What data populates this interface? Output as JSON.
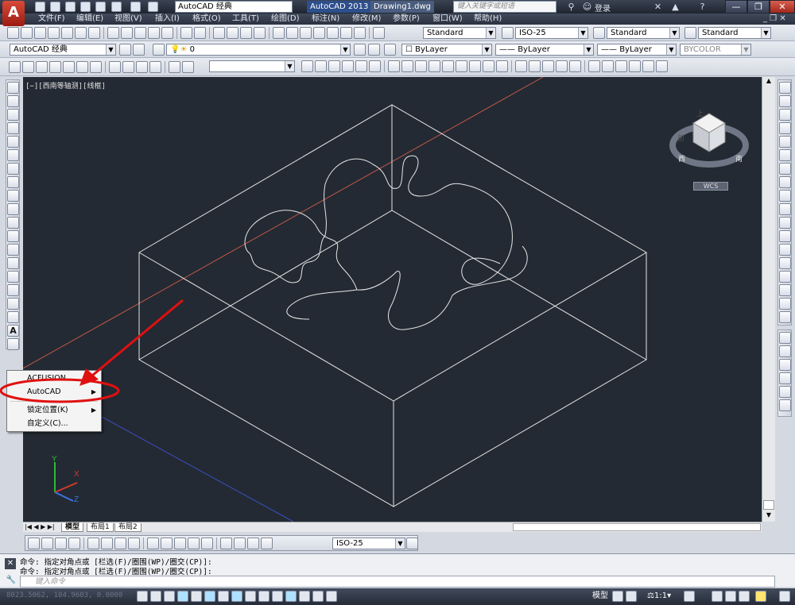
{
  "app": {
    "logo": "A",
    "workspace": "AutoCAD 经典",
    "title_app": "AutoCAD 2013",
    "title_doc": "Drawing1.dwg",
    "search_placeholder": "键入关键字或短语",
    "login": "登录"
  },
  "menubar": [
    "文件(F)",
    "编辑(E)",
    "视图(V)",
    "插入(I)",
    "格式(O)",
    "工具(T)",
    "绘图(D)",
    "标注(N)",
    "修改(M)",
    "参数(P)",
    "窗口(W)",
    "帮助(H)"
  ],
  "styles_toolbar": {
    "text_style": "Standard",
    "dim_style": "ISO-25",
    "table_style": "Standard",
    "multileader_style": "Standard"
  },
  "layers_toolbar": {
    "workspace_combo": "AutoCAD 经典",
    "layer": "0",
    "color": "ByLayer",
    "linetype": "ByLayer",
    "lineweight": "ByLayer",
    "plotstyle": "BYCOLOR"
  },
  "viewport": {
    "label": "[−][西南等轴测][线框]",
    "viewcube_top": "上",
    "viewcube_front": "前",
    "compass_w": "西",
    "compass_s": "南",
    "wcs_label": "WCS"
  },
  "context_menu": {
    "items": [
      {
        "label": "ACFUSION",
        "submenu": false
      },
      {
        "label": "AutoCAD",
        "submenu": true
      },
      {
        "label": "锁定位置(K)",
        "submenu": true
      },
      {
        "label": "自定义(C)...",
        "submenu": false
      }
    ]
  },
  "annotation": {
    "color": "#e01010"
  },
  "tabs": [
    "模型",
    "布局1",
    "布局2"
  ],
  "dim_toolbar": {
    "dim_style": "ISO-25"
  },
  "command": {
    "history": [
      "命令: 指定对角点或 [栏选(F)/圈围(WP)/圈交(CP)]:",
      "命令: 指定对角点或 [栏选(F)/圈围(WP)/圈交(CP)]:"
    ],
    "placeholder": "键入命令"
  },
  "status": {
    "coordinates": "8023.5062, 104.9603, 0.0000",
    "model": "模型",
    "scale": "1:1"
  },
  "colors": {
    "canvas": "#232a33",
    "wire": "#e6e6e6",
    "redaxis": "#c85a4a",
    "blueaxis": "#3a50c8"
  }
}
